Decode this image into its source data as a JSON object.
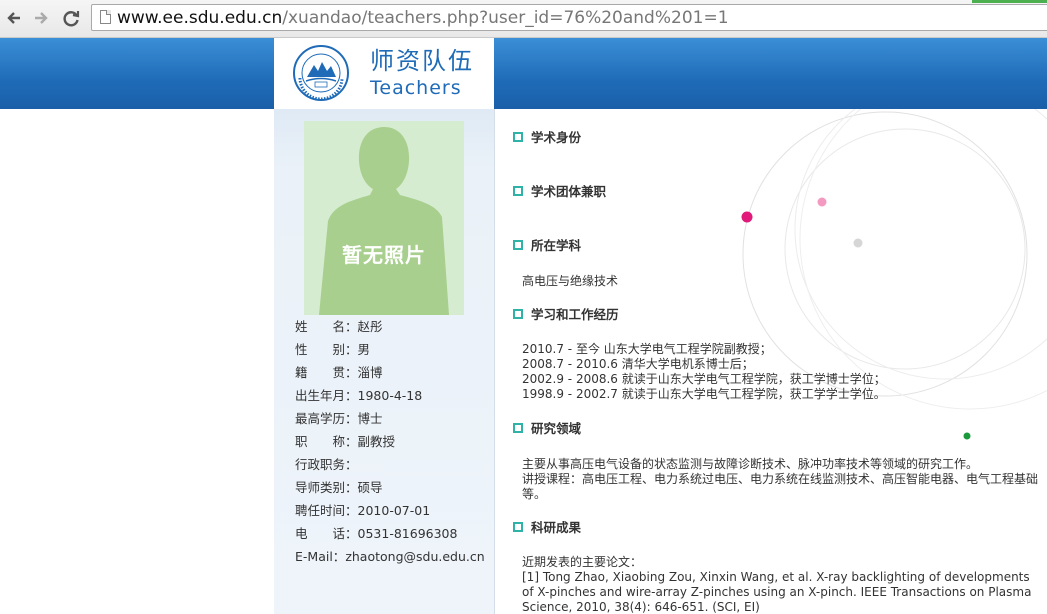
{
  "browser": {
    "back_icon": "arrow-left-icon",
    "forward_icon": "arrow-right-icon",
    "reload_icon": "reload-icon",
    "url_host": "www.ee.sdu.edu.cn",
    "url_path": "/xuandao/teachers.php?user_id=76%20and%201=1"
  },
  "header": {
    "title_cn": "师资队伍",
    "title_en": "Teachers",
    "brand_color": "#1f6bb8"
  },
  "profile": {
    "photo_placeholder": "暂无照片",
    "fields": [
      {
        "label": "姓　　名：",
        "value": "赵彤"
      },
      {
        "label": "性　　别：",
        "value": "男"
      },
      {
        "label": "籍　　贯：",
        "value": "淄博"
      },
      {
        "label": "出生年月：",
        "value": "1980-4-18"
      },
      {
        "label": "最高学历：",
        "value": "博士"
      },
      {
        "label": "职　　称：",
        "value": "副教授"
      },
      {
        "label": "行政职务：",
        "value": ""
      },
      {
        "label": "导师类别：",
        "value": "硕导"
      },
      {
        "label": "聘任时间：",
        "value": "2010-07-01"
      },
      {
        "label": "电　　话：",
        "value": "0531-81696308"
      },
      {
        "label": "E-Mail：",
        "value": "zhaotong@sdu.edu.cn"
      }
    ]
  },
  "sections": {
    "academic_identity": {
      "title": "学术身份"
    },
    "academic_posts": {
      "title": "学术团体兼职"
    },
    "discipline": {
      "title": "所在学科",
      "body": "高电压与绝缘技术"
    },
    "experience": {
      "title": "学习和工作经历",
      "lines": [
        "2010.7 - 至今 山东大学电气工程学院副教授；",
        "2008.7 - 2010.6 清华大学电机系博士后；",
        "2002.9 - 2008.6 就读于山东大学电气工程学院，获工学博士学位；",
        "1998.9 - 2002.7 就读于山东大学电气工程学院，获工学学士学位。"
      ]
    },
    "research": {
      "title": "研究领域",
      "lines": [
        "主要从事高压电气设备的状态监测与故障诊断技术、脉冲功率技术等领域的研究工作。",
        "讲授课程：高电压工程、电力系统过电压、电力系统在线监测技术、高压智能电器、电气工程基础等。"
      ]
    },
    "results": {
      "title": "科研成果",
      "lines": [
        "近期发表的主要论文：",
        "[1] Tong Zhao, Xiaobing Zou, Xinxin Wang, et al. X-ray backlighting of developments of X-pinches and wire-array Z-pinches using an X-pinch. IEEE Transactions on Plasma Science, 2010, 38(4): 646-651. (SCI, EI)"
      ]
    }
  },
  "colors": {
    "bullet": "#2fb3a8",
    "dot_magenta": "#e0197a",
    "dot_pink": "#f49ac1",
    "dot_grey": "#d6d6d6",
    "dot_green": "#1a9a3c"
  }
}
